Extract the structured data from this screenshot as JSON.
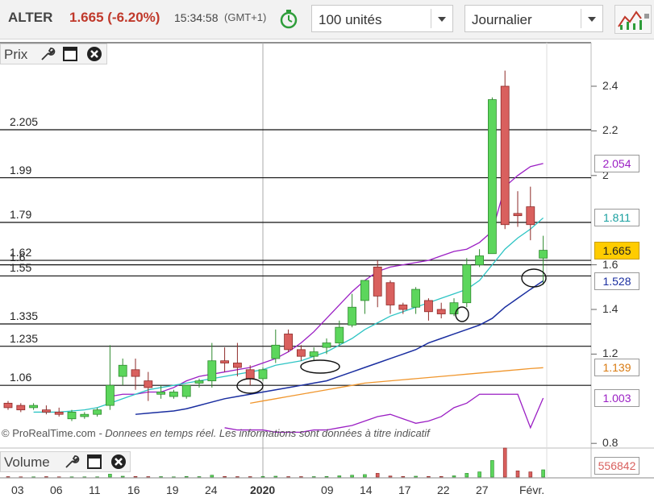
{
  "header": {
    "ticker": "ALTER",
    "price_change": "1.665 (-6.20%)",
    "time": "15:34:58",
    "timezone": "(GMT+1)",
    "quantity_select": "100 unités",
    "period_select": "Journalier"
  },
  "price_panel": {
    "title": "Prix"
  },
  "volume_panel": {
    "title": "Volume",
    "last_volume": "556842"
  },
  "copyright": {
    "brand": "© ProRealTime.com",
    "note": " - Donnees en temps réel. Les informations sont données à titre indicatif"
  },
  "colors": {
    "up": "#5cd65c",
    "down": "#d9605e",
    "ma_fast": "#2ec4c4",
    "ma_mid": "#1a2ea0",
    "ma_slow": "#f0962d",
    "bollinger": "#9b1fc4",
    "last_price_bg": "#ffcc00"
  },
  "chart_data": {
    "type": "candlestick",
    "ylim": [
      0.8,
      2.5
    ],
    "y_ticks": [
      {
        "value": 0.8,
        "label": "0.8"
      },
      {
        "value": 1.2,
        "label": "1.2"
      },
      {
        "value": 1.4,
        "label": "1.4"
      },
      {
        "value": 1.6,
        "label": "1.6"
      },
      {
        "value": 2.0,
        "label": "2"
      },
      {
        "value": 2.2,
        "label": "2.2"
      },
      {
        "value": 2.4,
        "label": "2.4"
      }
    ],
    "x_labels": [
      "03",
      "06",
      "11",
      "16",
      "19",
      "24",
      "2020",
      "09",
      "14",
      "17",
      "22",
      "27",
      "Févr."
    ],
    "horizontal_levels": [
      {
        "value": 2.205,
        "label": "2.205"
      },
      {
        "value": 1.99,
        "label": "1.99"
      },
      {
        "value": 1.79,
        "label": "1.79"
      },
      {
        "value": 1.62,
        "label": "1.62"
      },
      {
        "value": 1.6,
        "label": "1.6"
      },
      {
        "value": 1.55,
        "label": "1.55"
      },
      {
        "value": 1.335,
        "label": "1.335"
      },
      {
        "value": 1.235,
        "label": "1.235"
      },
      {
        "value": 1.06,
        "label": "1.06"
      }
    ],
    "value_boxes": [
      {
        "value": 2.054,
        "label": "2.054",
        "series": "bollinger_upper"
      },
      {
        "value": 1.811,
        "label": "1.811",
        "series": "ma_fast"
      },
      {
        "value": 1.665,
        "label": "1.665",
        "series": "last_price"
      },
      {
        "value": 1.528,
        "label": "1.528",
        "series": "ma_mid"
      },
      {
        "value": 1.139,
        "label": "1.139",
        "series": "ma_slow"
      },
      {
        "value": 1.003,
        "label": "1.003",
        "series": "bollinger_lower"
      }
    ],
    "candles": [
      {
        "o": 0.98,
        "h": 0.99,
        "l": 0.95,
        "c": 0.96
      },
      {
        "o": 0.97,
        "h": 0.98,
        "l": 0.94,
        "c": 0.95
      },
      {
        "o": 0.96,
        "h": 0.98,
        "l": 0.95,
        "c": 0.97
      },
      {
        "o": 0.95,
        "h": 0.97,
        "l": 0.93,
        "c": 0.94
      },
      {
        "o": 0.94,
        "h": 0.96,
        "l": 0.92,
        "c": 0.93
      },
      {
        "o": 0.91,
        "h": 0.95,
        "l": 0.9,
        "c": 0.94
      },
      {
        "o": 0.92,
        "h": 0.94,
        "l": 0.91,
        "c": 0.93
      },
      {
        "o": 0.93,
        "h": 0.96,
        "l": 0.92,
        "c": 0.95
      },
      {
        "o": 0.97,
        "h": 1.24,
        "l": 0.95,
        "c": 1.06
      },
      {
        "o": 1.1,
        "h": 1.18,
        "l": 1.06,
        "c": 1.15
      },
      {
        "o": 1.13,
        "h": 1.18,
        "l": 1.04,
        "c": 1.1
      },
      {
        "o": 1.08,
        "h": 1.12,
        "l": 0.99,
        "c": 1.05
      },
      {
        "o": 1.02,
        "h": 1.06,
        "l": 1.0,
        "c": 1.03
      },
      {
        "o": 1.01,
        "h": 1.04,
        "l": 1.0,
        "c": 1.03
      },
      {
        "o": 1.01,
        "h": 1.06,
        "l": 1.0,
        "c": 1.06
      },
      {
        "o": 1.07,
        "h": 1.09,
        "l": 1.05,
        "c": 1.08
      },
      {
        "o": 1.08,
        "h": 1.25,
        "l": 1.05,
        "c": 1.17
      },
      {
        "o": 1.17,
        "h": 1.23,
        "l": 1.12,
        "c": 1.16
      },
      {
        "o": 1.16,
        "h": 1.25,
        "l": 1.1,
        "c": 1.14
      },
      {
        "o": 1.13,
        "h": 1.15,
        "l": 1.06,
        "c": 1.09
      },
      {
        "o": 1.09,
        "h": 1.14,
        "l": 1.08,
        "c": 1.13
      },
      {
        "o": 1.18,
        "h": 1.31,
        "l": 1.16,
        "c": 1.24
      },
      {
        "o": 1.29,
        "h": 1.31,
        "l": 1.21,
        "c": 1.22
      },
      {
        "o": 1.22,
        "h": 1.24,
        "l": 1.17,
        "c": 1.19
      },
      {
        "o": 1.19,
        "h": 1.23,
        "l": 1.17,
        "c": 1.21
      },
      {
        "o": 1.23,
        "h": 1.27,
        "l": 1.2,
        "c": 1.25
      },
      {
        "o": 1.25,
        "h": 1.35,
        "l": 1.24,
        "c": 1.32
      },
      {
        "o": 1.33,
        "h": 1.47,
        "l": 1.32,
        "c": 1.41
      },
      {
        "o": 1.44,
        "h": 1.52,
        "l": 1.38,
        "c": 1.53
      },
      {
        "o": 1.59,
        "h": 1.62,
        "l": 1.41,
        "c": 1.46
      },
      {
        "o": 1.52,
        "h": 1.53,
        "l": 1.38,
        "c": 1.42
      },
      {
        "o": 1.42,
        "h": 1.43,
        "l": 1.38,
        "c": 1.4
      },
      {
        "o": 1.41,
        "h": 1.5,
        "l": 1.38,
        "c": 1.49
      },
      {
        "o": 1.44,
        "h": 1.45,
        "l": 1.35,
        "c": 1.39
      },
      {
        "o": 1.4,
        "h": 1.43,
        "l": 1.36,
        "c": 1.38
      },
      {
        "o": 1.38,
        "h": 1.45,
        "l": 1.37,
        "c": 1.43
      },
      {
        "o": 1.43,
        "h": 1.63,
        "l": 1.41,
        "c": 1.6
      },
      {
        "o": 1.6,
        "h": 1.67,
        "l": 1.59,
        "c": 1.64
      },
      {
        "o": 1.65,
        "h": 2.35,
        "l": 1.65,
        "c": 2.34
      },
      {
        "o": 2.4,
        "h": 2.47,
        "l": 1.76,
        "c": 1.78
      },
      {
        "o": 1.83,
        "h": 1.93,
        "l": 1.77,
        "c": 1.82
      },
      {
        "o": 1.86,
        "h": 1.95,
        "l": 1.71,
        "c": 1.78
      },
      {
        "o": 1.63,
        "h": 1.73,
        "l": 1.51,
        "c": 1.665
      }
    ],
    "ma_fast": [
      0.94,
      0.94,
      0.94,
      0.945,
      0.95,
      0.96,
      0.98,
      1.0,
      1.02,
      1.04,
      1.05,
      1.06,
      1.07,
      1.08,
      1.09,
      1.1,
      1.11,
      1.12,
      1.13,
      1.15,
      1.16,
      1.17,
      1.19,
      1.21,
      1.24,
      1.27,
      1.31,
      1.34,
      1.37,
      1.39,
      1.41,
      1.43,
      1.45,
      1.47,
      1.49,
      1.53,
      1.6,
      1.67,
      1.72,
      1.76,
      1.81
    ],
    "ma_mid": [
      0.93,
      0.935,
      0.94,
      0.945,
      0.955,
      0.97,
      0.985,
      1.0,
      1.01,
      1.02,
      1.03,
      1.04,
      1.05,
      1.06,
      1.07,
      1.08,
      1.1,
      1.12,
      1.14,
      1.16,
      1.18,
      1.2,
      1.22,
      1.25,
      1.27,
      1.29,
      1.31,
      1.33,
      1.36,
      1.41,
      1.45,
      1.49,
      1.528
    ],
    "ma_slow": [
      0.98,
      0.99,
      1.0,
      1.01,
      1.02,
      1.03,
      1.04,
      1.05,
      1.06,
      1.07,
      1.075,
      1.08,
      1.085,
      1.09,
      1.095,
      1.1,
      1.105,
      1.11,
      1.115,
      1.12,
      1.125,
      1.13,
      1.135,
      1.139
    ],
    "bollinger_upper": [
      1.01,
      1.02,
      1.02,
      1.03,
      1.03,
      1.05,
      1.08,
      1.1,
      1.11,
      1.12,
      1.13,
      1.14,
      1.16,
      1.18,
      1.21,
      1.25,
      1.3,
      1.36,
      1.42,
      1.48,
      1.53,
      1.57,
      1.59,
      1.6,
      1.61,
      1.62,
      1.64,
      1.66,
      1.67,
      1.7,
      1.75,
      1.95,
      2.0,
      2.04,
      2.054
    ],
    "bollinger_lower": [
      0.87,
      0.86,
      0.86,
      0.86,
      0.85,
      0.85,
      0.85,
      0.86,
      0.86,
      0.87,
      0.88,
      0.9,
      0.92,
      0.93,
      0.91,
      0.89,
      0.9,
      0.92,
      0.96,
      0.98,
      1.02,
      1.02,
      1.02,
      1.02,
      0.87,
      1.003
    ],
    "volumes": [
      2,
      1,
      1,
      2,
      1,
      1,
      1,
      1,
      14,
      4,
      3,
      2,
      2,
      1,
      3,
      2,
      9,
      3,
      2,
      2,
      3,
      4,
      2,
      2,
      2,
      3,
      6,
      9,
      12,
      18,
      5,
      3,
      4,
      3,
      3,
      6,
      18,
      25,
      80,
      140,
      30,
      25,
      35
    ]
  }
}
